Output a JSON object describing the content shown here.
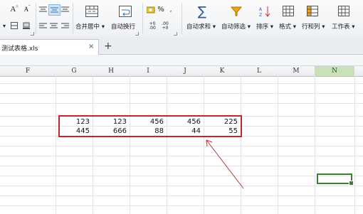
{
  "ribbon": {
    "font_size_up": "A",
    "font_size_down": "A",
    "merge_center_label": "合并居中",
    "wrap_text_label": "自动换行",
    "percent_label": "%",
    "autosum_label": "自动求和",
    "autofilter_label": "自动筛选",
    "sort_label": "排序",
    "format_label": "格式",
    "rows_cols_label": "行和列",
    "worksheet_label": "工作表"
  },
  "tab": {
    "name": "测试表格.xls",
    "close": "×",
    "new_tab": "+"
  },
  "columns": [
    {
      "label": "F"
    },
    {
      "label": "G"
    },
    {
      "label": "H"
    },
    {
      "label": "I"
    },
    {
      "label": "J"
    },
    {
      "label": "K"
    },
    {
      "label": "L"
    },
    {
      "label": "M"
    },
    {
      "label": "N"
    }
  ],
  "table": {
    "rows": [
      [
        "123",
        "123",
        "456",
        "456",
        "225"
      ],
      [
        "445",
        "666",
        "88",
        "44",
        "55"
      ]
    ]
  },
  "colors": {
    "highlight": "#c0272d",
    "active_cell": "#3f7f34",
    "selected_col_header": "#c9e0b8"
  }
}
